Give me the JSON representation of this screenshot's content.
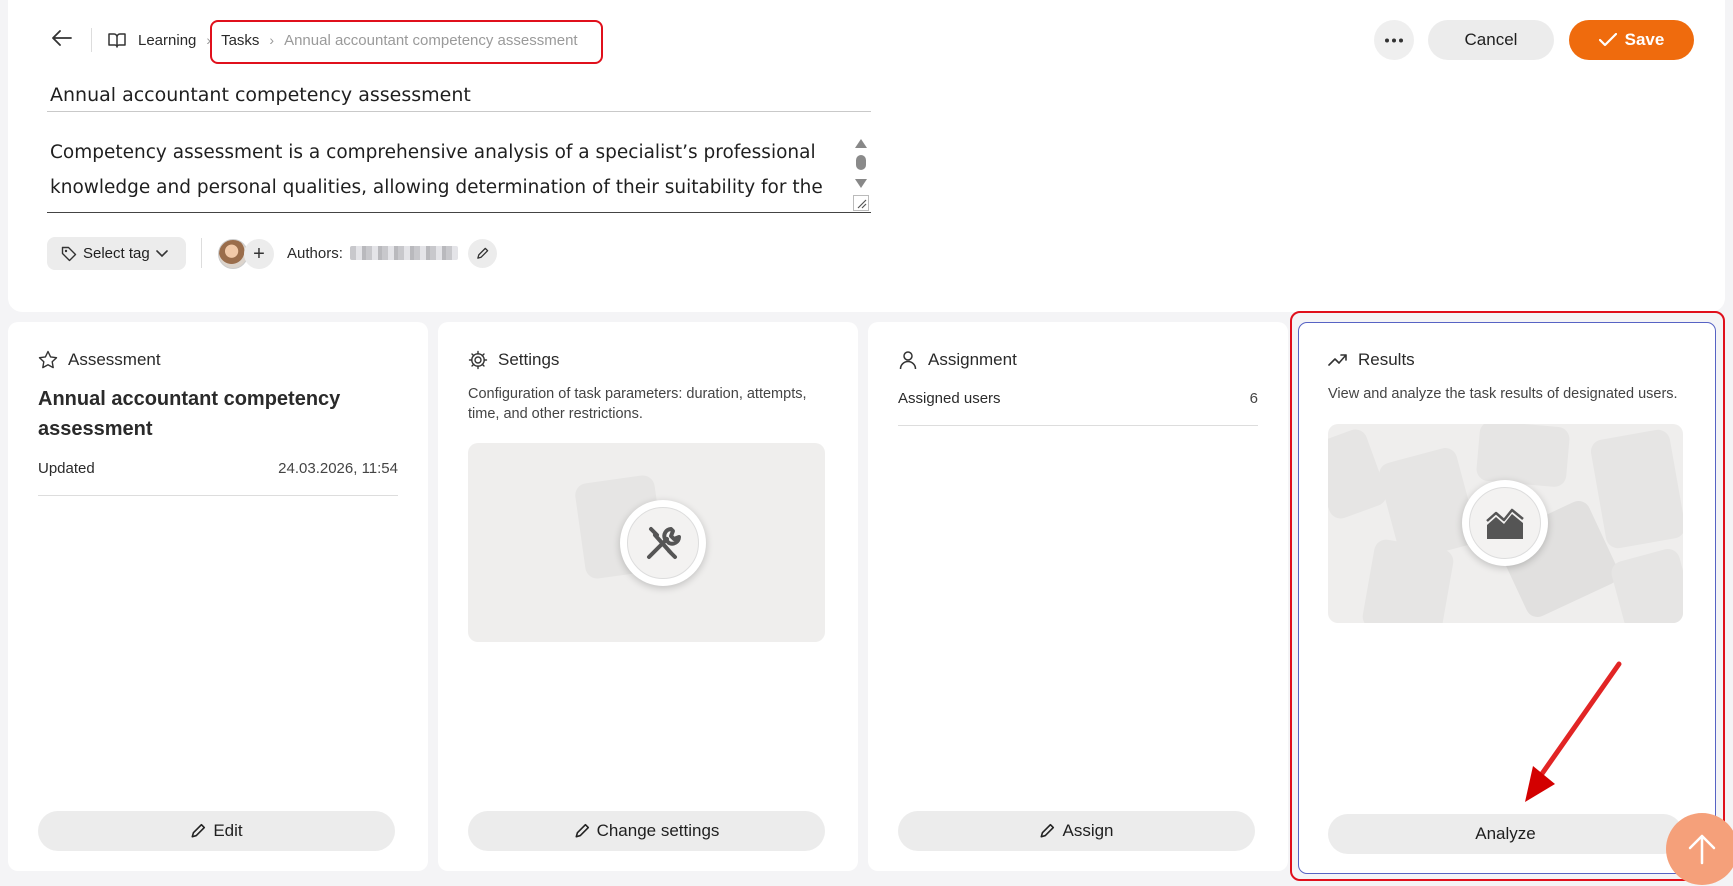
{
  "breadcrumb": {
    "root": "Learning",
    "tasks": "Tasks",
    "current": "Annual accountant competency assessment"
  },
  "actions": {
    "cancel_label": "Cancel",
    "save_label": "Save"
  },
  "task": {
    "title": "Annual accountant competency assessment",
    "description": "Competency assessment is a comprehensive analysis of a specialist’s professional knowledge and personal qualities, allowing determination of their suitability for the"
  },
  "meta": {
    "tag_label": "Select tag",
    "authors_label": "Authors:"
  },
  "cards": {
    "assessment": {
      "header": "Assessment",
      "title": "Annual accountant competency assessment",
      "updated_label": "Updated",
      "updated_value": "24.03.2026, 11:54",
      "button": "Edit"
    },
    "settings": {
      "header": "Settings",
      "description": "Configuration of task parameters: duration, attempts, time, and other restrictions.",
      "button": "Change settings"
    },
    "assignment": {
      "header": "Assignment",
      "assigned_label": "Assigned users",
      "assigned_count": "6",
      "button": "Assign"
    },
    "results": {
      "header": "Results",
      "description": "View and analyze the task results of designated users.",
      "button": "Analyze"
    }
  },
  "colors": {
    "accent": "#ef6b0d",
    "highlight": "#e0101c",
    "card_bg": "#ffffff",
    "page_bg": "#f4f4f6"
  }
}
